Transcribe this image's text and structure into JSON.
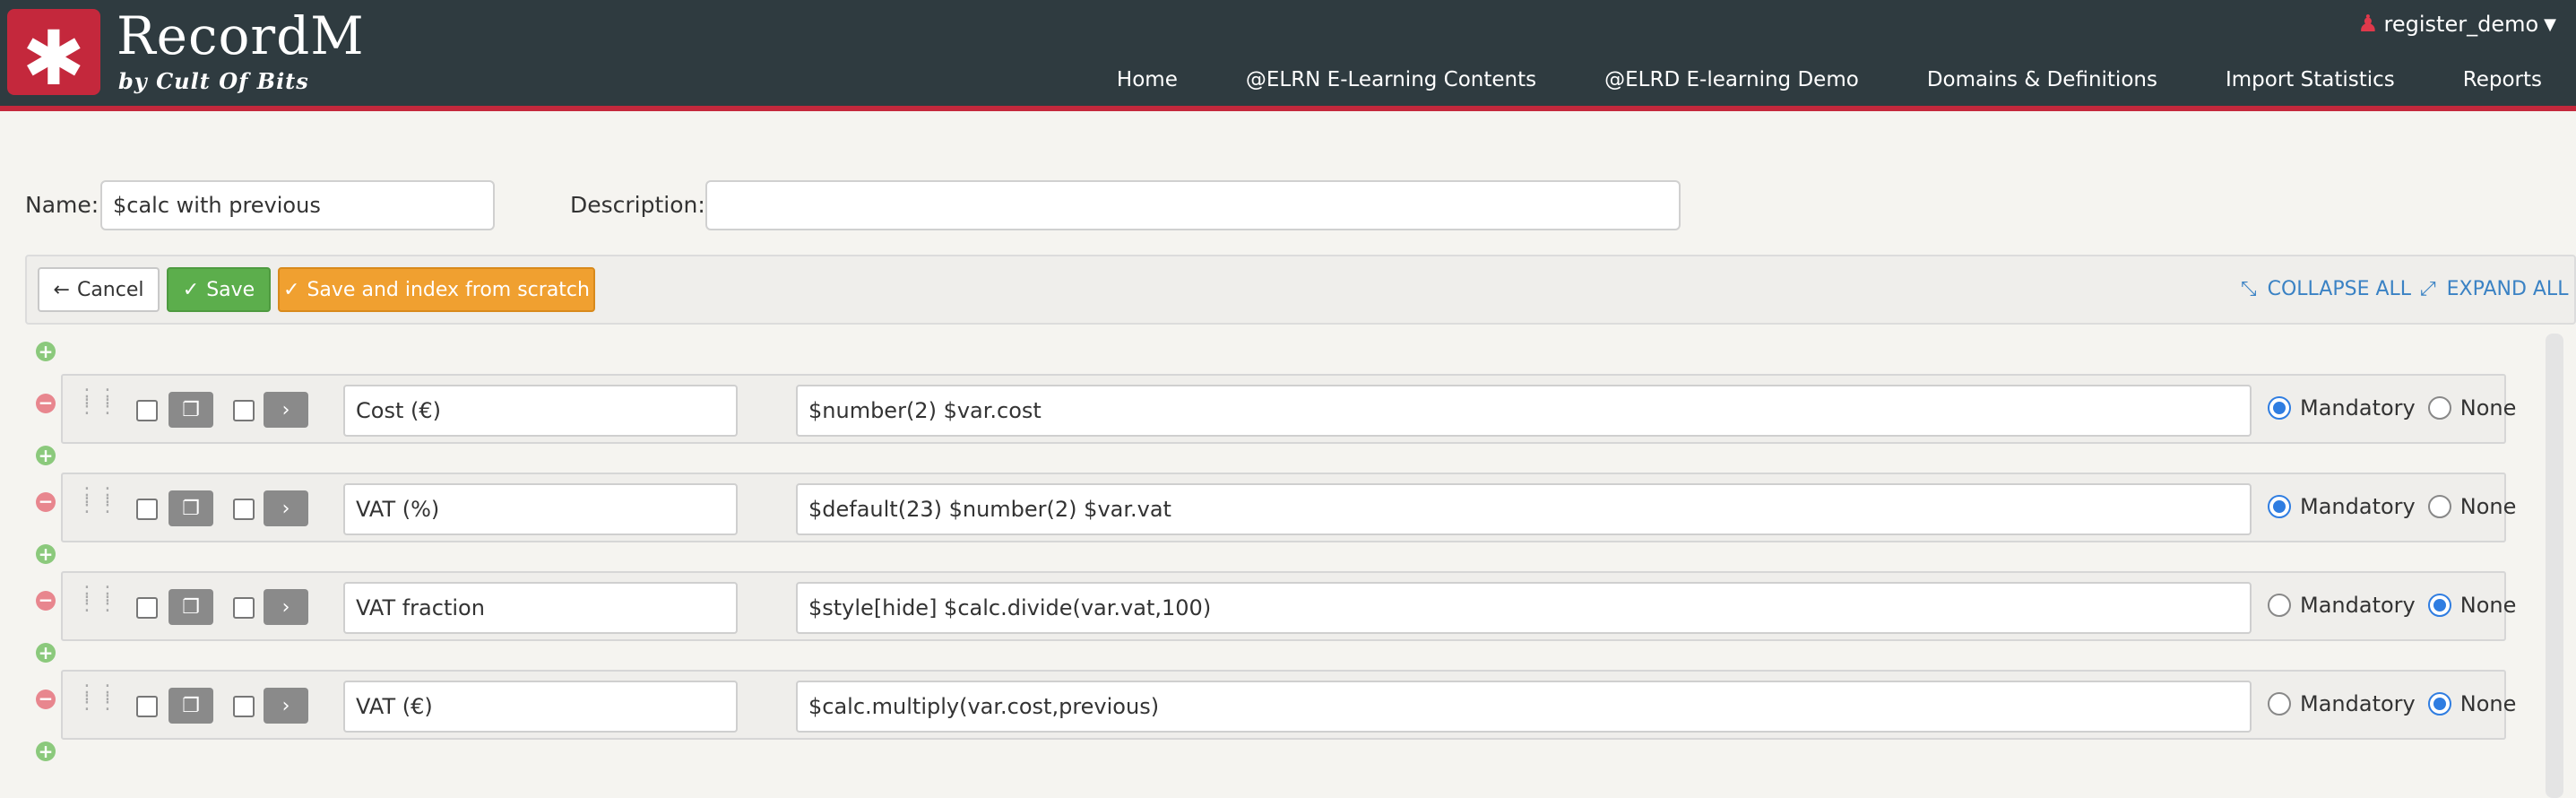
{
  "header": {
    "logo_glyph": "✱",
    "brand_title": "RecordM",
    "brand_subtitle": "by Cult Of Bits",
    "user": "register_demo",
    "nav": [
      "Home",
      "@ELRN E-Learning Contents",
      "@ELRD E-learning Demo",
      "Domains & Definitions",
      "Import Statistics",
      "Reports"
    ]
  },
  "form": {
    "name_label": "Name:",
    "name_value": "$calc with previous",
    "description_label": "Description:",
    "description_value": ""
  },
  "toolbar": {
    "cancel_label": "Cancel",
    "save_label": "Save",
    "save_index_label": "Save and index from scratch",
    "collapse_all": "COLLAPSE ALL",
    "expand_all": "EXPAND ALL"
  },
  "fields": [
    {
      "label": "Cost (€)",
      "expression": "$number(2) $var.cost",
      "selected": "Mandatory"
    },
    {
      "label": "VAT (%)",
      "expression": "$default(23) $number(2) $var.vat",
      "selected": "Mandatory"
    },
    {
      "label": "VAT fraction",
      "expression": "$style[hide] $calc.divide(var.vat,100)",
      "selected": "None"
    },
    {
      "label": "VAT (€)",
      "expression": "$calc.multiply(var.cost,previous)",
      "selected": "None"
    }
  ],
  "radio_options": {
    "mandatory": "Mandatory",
    "none": "None"
  },
  "colors": {
    "header_bg": "#2f3b40",
    "brand_red": "#c4283c",
    "save_green": "#5cae4c",
    "scratch_orange": "#f0a030",
    "link_blue": "#3a82c4",
    "radio_blue": "#2f7de1"
  }
}
